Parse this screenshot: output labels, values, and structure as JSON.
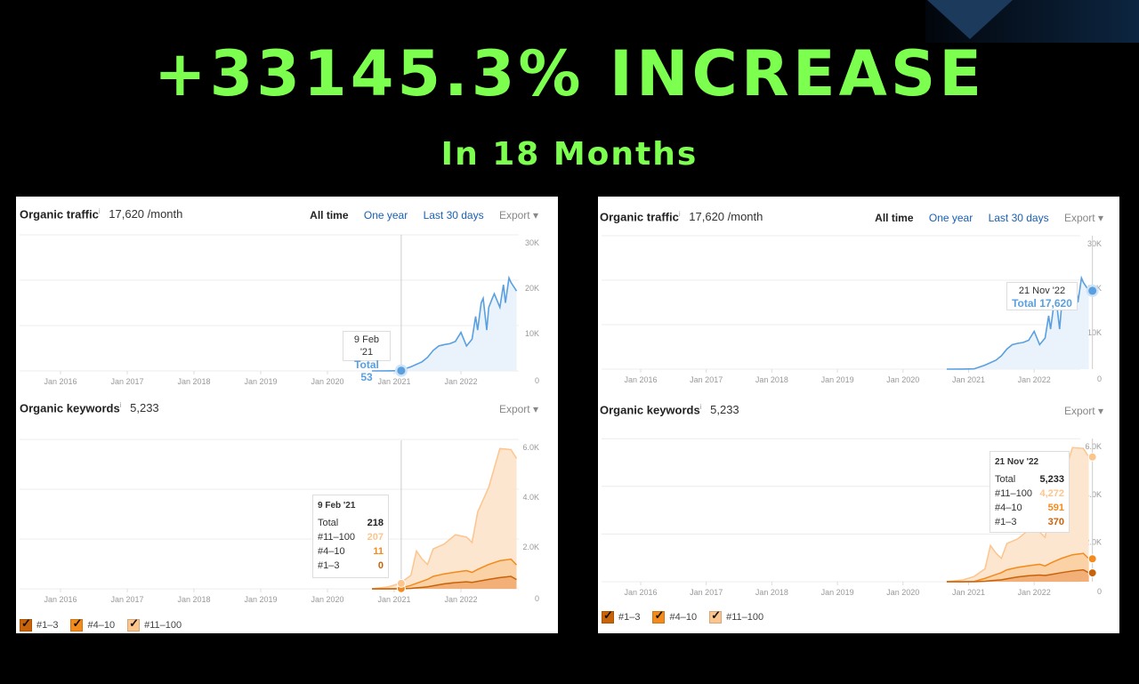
{
  "headline": "+33145.3% INCREASE",
  "subheadline": "In 18 Months",
  "colors": {
    "headline": "#7dff4f",
    "traffic": "#5aa0e0",
    "rank_1_3": "#c8630a",
    "rank_4_10": "#f28a1c",
    "rank_11_100": "#fcc58e"
  },
  "panels": [
    {
      "traffic_header": {
        "title": "Organic traffic",
        "info": "i",
        "value": "17,620 /month"
      },
      "tabs": [
        "All time",
        "One year",
        "Last 30 days"
      ],
      "export": "Export ▾",
      "keywords_header": {
        "title": "Organic keywords",
        "info": "i",
        "value": "5,233"
      },
      "keywords_export": "Export ▾",
      "traffic_tooltip": {
        "date": "9 Feb '21",
        "total": "Total 53"
      },
      "keywords_tooltip": {
        "date": "9 Feb '21",
        "rows": [
          {
            "label": "Total",
            "value": "218"
          },
          {
            "label": "#11–100",
            "value": "207"
          },
          {
            "label": "#4–10",
            "value": "11"
          },
          {
            "label": "#1–3",
            "value": "0"
          }
        ]
      },
      "legend": [
        "#1–3",
        "#4–10",
        "#11–100"
      ]
    },
    {
      "traffic_header": {
        "title": "Organic traffic",
        "info": "i",
        "value": "17,620 /month"
      },
      "tabs": [
        "All time",
        "One year",
        "Last 30 days"
      ],
      "export": "Export ▾",
      "keywords_header": {
        "title": "Organic keywords",
        "info": "i",
        "value": "5,233"
      },
      "keywords_export": "Export ▾",
      "traffic_tooltip": {
        "date": "21 Nov '22",
        "total": "Total 17,620"
      },
      "keywords_tooltip": {
        "date": "21 Nov '22",
        "rows": [
          {
            "label": "Total",
            "value": "5,233"
          },
          {
            "label": "#11–100",
            "value": "4,272"
          },
          {
            "label": "#4–10",
            "value": "591"
          },
          {
            "label": "#1–3",
            "value": "370"
          }
        ]
      },
      "legend": [
        "#1–3",
        "#4–10",
        "#11–100"
      ]
    }
  ],
  "chart_data": [
    {
      "type": "area",
      "title": "Organic traffic",
      "x_ticks": [
        "Jan 2016",
        "Jan 2017",
        "Jan 2018",
        "Jan 2019",
        "Jan 2020",
        "Jan 2021",
        "Jan 2022"
      ],
      "y_ticks": [
        "0",
        "10K",
        "20K",
        "30K"
      ],
      "ylim": [
        0,
        30000
      ],
      "grid": true,
      "x": [
        "2020-09",
        "2020-12",
        "2021-02",
        "2021-04",
        "2021-06",
        "2021-07",
        "2021-08",
        "2021-09",
        "2021-10",
        "2021-11",
        "2021-12",
        "2022-01",
        "2022-02",
        "2022-03",
        "2022-03",
        "2022-04",
        "2022-04",
        "2022-05",
        "2022-05",
        "2022-06",
        "2022-06",
        "2022-07",
        "2022-08",
        "2022-08",
        "2022-09",
        "2022-09",
        "2022-10",
        "2022-11"
      ],
      "values": [
        0,
        20,
        53,
        900,
        2000,
        3000,
        4500,
        5500,
        5800,
        6000,
        6500,
        8500,
        5500,
        7000,
        12000,
        9000,
        15000,
        16000,
        9000,
        14000,
        16000,
        17000,
        14000,
        19000,
        15000,
        20500,
        19500,
        17620
      ]
    },
    {
      "type": "area",
      "title": "Organic keywords",
      "stacked": true,
      "x_ticks": [
        "Jan 2016",
        "Jan 2017",
        "Jan 2018",
        "Jan 2019",
        "Jan 2020",
        "Jan 2021",
        "Jan 2022"
      ],
      "y_ticks": [
        "0",
        "2.0K",
        "4.0K",
        "6.0K"
      ],
      "ylim": [
        0,
        6000
      ],
      "grid": true,
      "x": [
        "2020-09",
        "2020-12",
        "2021-02",
        "2021-04",
        "2021-05",
        "2021-06",
        "2021-07",
        "2021-08",
        "2021-10",
        "2021-12",
        "2022-02",
        "2022-03",
        "2022-04",
        "2022-06",
        "2022-08",
        "2022-10",
        "2022-11"
      ],
      "series": [
        {
          "name": "#1–3",
          "values": [
            0,
            0,
            0,
            20,
            40,
            60,
            80,
            120,
            200,
            250,
            280,
            260,
            300,
            380,
            450,
            500,
            370
          ]
        },
        {
          "name": "#4–10",
          "values": [
            0,
            0,
            11,
            120,
            180,
            240,
            300,
            380,
            400,
            420,
            450,
            400,
            480,
            600,
            680,
            690,
            591
          ]
        },
        {
          "name": "#11–100",
          "values": [
            0,
            80,
            207,
            400,
            1300,
            900,
            600,
            1100,
            1200,
            1500,
            1350,
            1200,
            2300,
            3100,
            4500,
            4400,
            4272
          ]
        }
      ]
    }
  ]
}
